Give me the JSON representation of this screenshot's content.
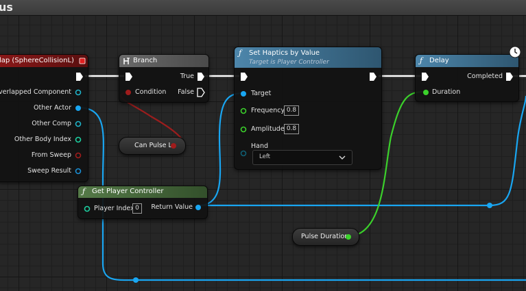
{
  "window": {
    "title_fragment": "us"
  },
  "nodes": {
    "overlap_event": {
      "title": "lap (SphereCollisionL)",
      "pins": {
        "overlapped_component": "Overlapped Component",
        "other_actor": "Other Actor",
        "other_comp": "Other Comp",
        "other_body_index": "Other Body Index",
        "from_sweep": "From Sweep",
        "sweep_result": "Sweep Result"
      }
    },
    "branch": {
      "title": "Branch",
      "pins": {
        "condition": "Condition",
        "true": "True",
        "false": "False"
      }
    },
    "set_haptics": {
      "title": "Set Haptics by Value",
      "subtitle": "Target is Player Controller",
      "pins": {
        "target": "Target",
        "frequency": "Frequency",
        "frequency_value": "0.8",
        "amplitude": "Amplitude",
        "amplitude_value": "0.8",
        "hand": "Hand",
        "hand_value": "Left"
      }
    },
    "delay": {
      "title": "Delay",
      "pins": {
        "duration": "Duration",
        "completed": "Completed"
      }
    },
    "get_player_controller": {
      "title": "Get Player Controller",
      "pins": {
        "player_index": "Player Index",
        "player_index_value": "0",
        "return_value": "Return Value"
      }
    },
    "can_pulse": {
      "label": "Can Pulse L"
    },
    "pulse_duration": {
      "label": "Pulse Duration"
    }
  },
  "colors": {
    "exec_wire": "#ffffff",
    "object_pin": "#19a6f2",
    "bool_pin": "#9b1d1d",
    "float_pin": "#3bd12b",
    "struct_pin": "#1a8fd6",
    "event_header": "#7c1313",
    "function_header": "#3f6e8d",
    "pure_header": "#4a6b3e",
    "branch_header": "#5a5a5a"
  },
  "icons": {
    "exec_pin": "exec-arrow-icon",
    "function": "function-icon",
    "branch": "branch-icon",
    "clock": "clock-icon",
    "dropdown": "chevron-down-icon"
  }
}
